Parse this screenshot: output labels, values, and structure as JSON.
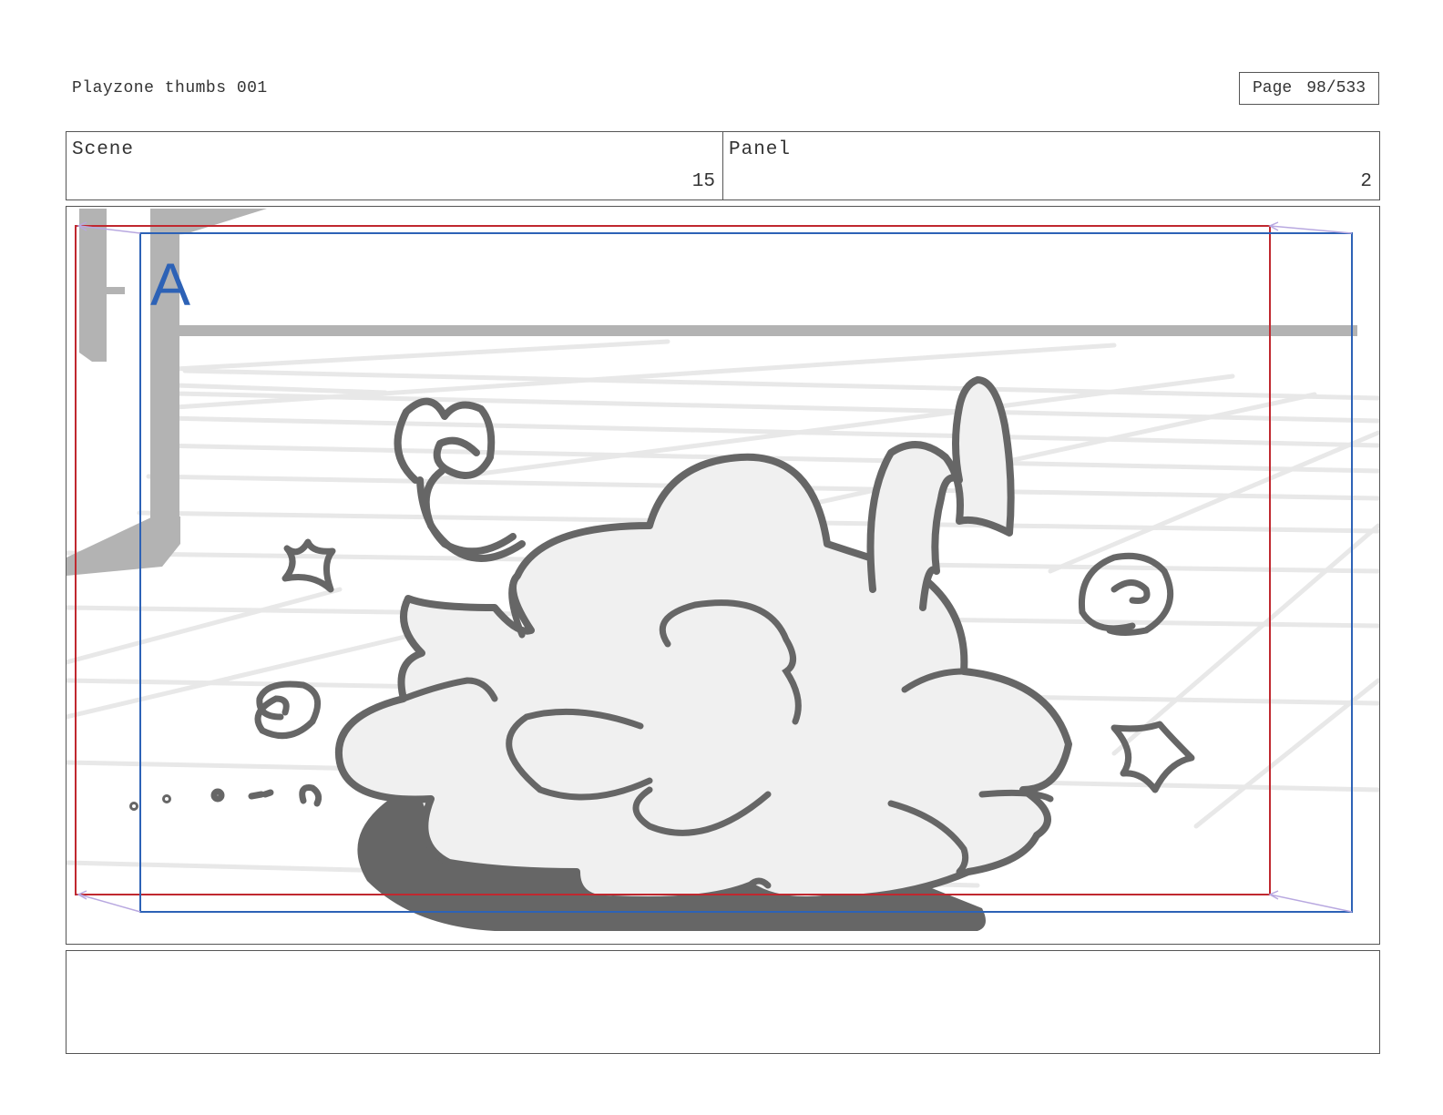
{
  "header": {
    "project_title": "Playzone thumbs 001",
    "page_label": "Page",
    "page_value": "98/533"
  },
  "scene": {
    "label": "Scene",
    "value": "15"
  },
  "panel": {
    "label": "Panel",
    "value": "2",
    "layer_marker": "A"
  },
  "notes": {
    "text": ""
  },
  "colors": {
    "safe_frame_red": "#c0282f",
    "camera_frame_blue": "#2d62b6",
    "sketch_line": "#666666",
    "dust_fill": "#f0f0f0",
    "background_lines": "#e6e6e6"
  }
}
